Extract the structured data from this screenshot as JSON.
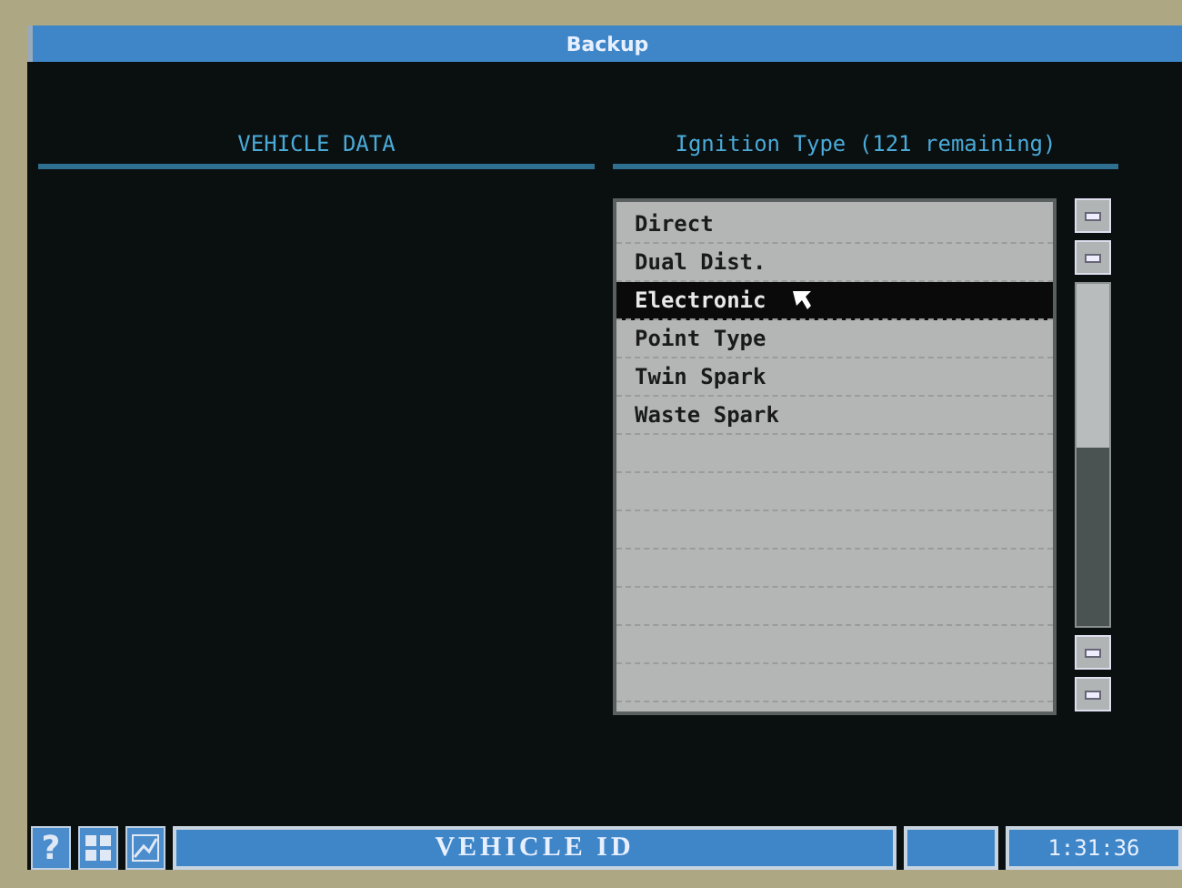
{
  "window": {
    "title": "Backup"
  },
  "left_panel": {
    "heading": "VEHICLE DATA"
  },
  "right_panel": {
    "heading": "Ignition Type (121 remaining)",
    "items": [
      {
        "label": "Direct",
        "selected": false
      },
      {
        "label": "Dual Dist.",
        "selected": false
      },
      {
        "label": "Electronic",
        "selected": true
      },
      {
        "label": "Point Type",
        "selected": false
      },
      {
        "label": "Twin Spark",
        "selected": false
      },
      {
        "label": "Waste Spark",
        "selected": false
      }
    ]
  },
  "status_bar": {
    "help": "?",
    "title": "VEHICLE ID",
    "time": "1:31:36"
  }
}
